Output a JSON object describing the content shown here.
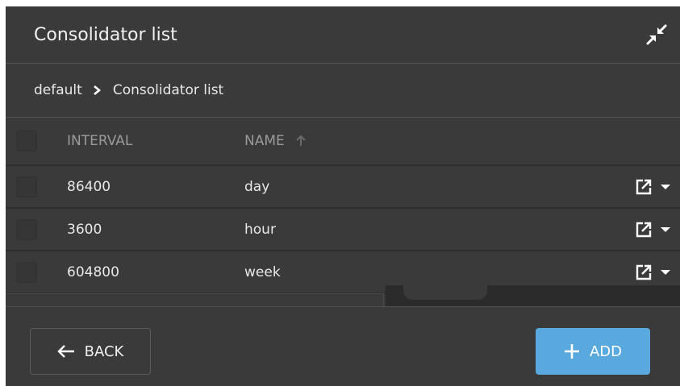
{
  "header": {
    "title": "Consolidator list",
    "collapse_icon": "collapse-arrows-icon"
  },
  "breadcrumb": {
    "root": "default",
    "current": "Consolidator list"
  },
  "table": {
    "columns": {
      "interval": "INTERVAL",
      "name": "NAME"
    },
    "rows": [
      {
        "interval": "86400",
        "name": "day"
      },
      {
        "interval": "3600",
        "name": "hour"
      },
      {
        "interval": "604800",
        "name": "week"
      }
    ]
  },
  "footer": {
    "back_label": "BACK",
    "add_label": "ADD"
  },
  "colors": {
    "accent": "#5aa9de",
    "panel": "#3a3a3a"
  }
}
